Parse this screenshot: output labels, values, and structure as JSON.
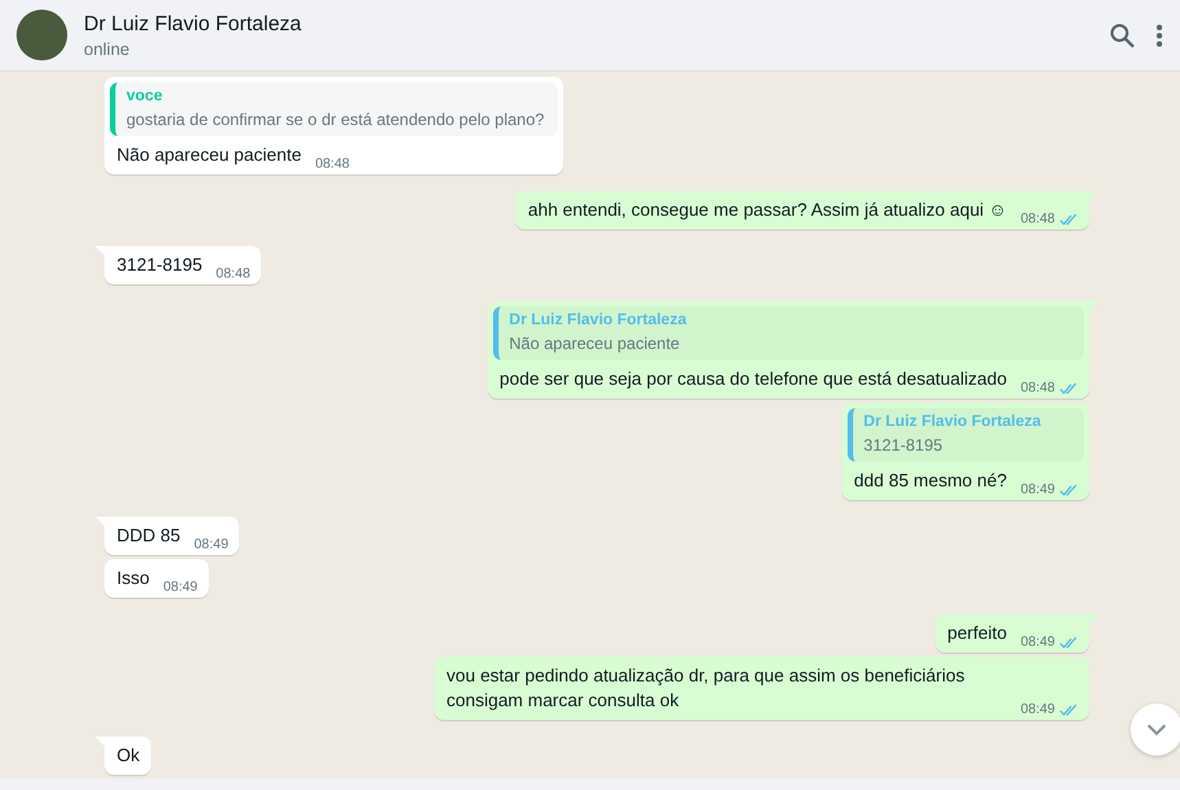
{
  "header": {
    "name": "Dr Luiz Flavio Fortaleza",
    "status": "online"
  },
  "messages": [
    {
      "outgoing": false,
      "quote": {
        "author": "voce",
        "kind": "mine",
        "text": "gostaria de confirmar se o dr está atendendo pelo plano?"
      },
      "text": "Não apareceu paciente",
      "time": "08:48"
    },
    {
      "outgoing": true,
      "text": "ahh entendi, consegue me passar? Assim já atualizo aqui ☺",
      "time": "08:48",
      "read": true
    },
    {
      "outgoing": false,
      "text": "3121-8195",
      "time": "08:48"
    },
    {
      "outgoing": true,
      "quote": {
        "author": "Dr Luiz Flavio Fortaleza",
        "kind": "theirs",
        "text": "Não apareceu paciente"
      },
      "text": "pode ser que seja por causa do telefone que está desatualizado",
      "time": "08:48",
      "read": true
    },
    {
      "outgoing": true,
      "quote": {
        "author": "Dr Luiz Flavio Fortaleza",
        "kind": "theirs",
        "text": "3121-8195"
      },
      "text": "ddd 85 mesmo né?",
      "time": "08:49",
      "read": true
    },
    {
      "outgoing": false,
      "text": "DDD 85",
      "time": "08:49"
    },
    {
      "outgoing": false,
      "text": "Isso",
      "time": "08:49"
    },
    {
      "outgoing": true,
      "text": "perfeito",
      "time": "08:49",
      "read": true
    },
    {
      "outgoing": true,
      "text": "vou estar pedindo atualização dr, para que assim os beneficiários consigam marcar consulta ok",
      "time": "08:49",
      "read": true
    },
    {
      "outgoing": false,
      "text": "Ok"
    }
  ]
}
